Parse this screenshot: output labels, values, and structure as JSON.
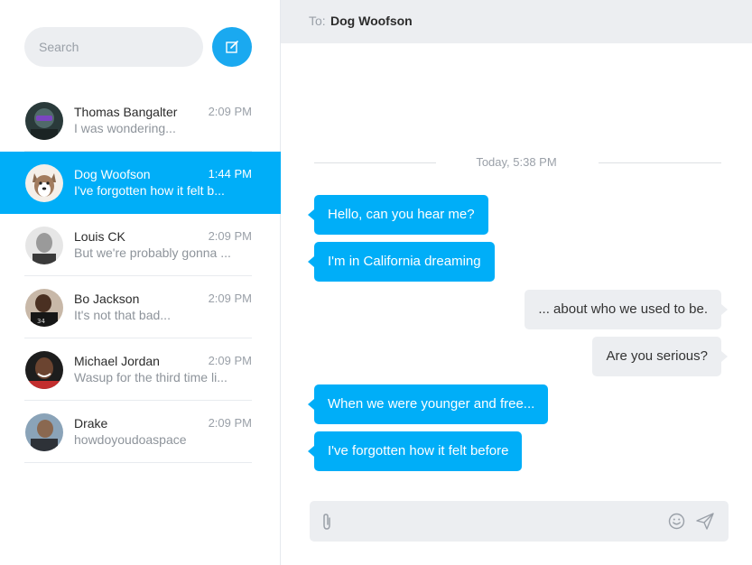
{
  "sidebar": {
    "search": {
      "placeholder": "Search",
      "value": ""
    },
    "compose": {
      "icon": "compose-icon",
      "color": "#1aa9f0"
    },
    "contacts": [
      {
        "name": "Thomas Bangalter",
        "time": "2:09 PM",
        "preview": "I was wondering...",
        "active": false
      },
      {
        "name": "Dog Woofson",
        "time": "1:44 PM",
        "preview": "I've forgotten how it felt b...",
        "active": true
      },
      {
        "name": "Louis CK",
        "time": "2:09 PM",
        "preview": "But we're probably gonna ...",
        "active": false
      },
      {
        "name": "Bo Jackson",
        "time": "2:09 PM",
        "preview": "It's not that bad...",
        "active": false
      },
      {
        "name": "Michael Jordan",
        "time": "2:09 PM",
        "preview": "Wasup for the third time li...",
        "active": false
      },
      {
        "name": "Drake",
        "time": "2:09 PM",
        "preview": "howdoyoudoaspace",
        "active": false
      }
    ]
  },
  "chat": {
    "to_label": "To:",
    "to_name": "Dog Woofson",
    "date_divider": "Today, 5:38 PM",
    "messages": [
      {
        "from": "me",
        "text": "Hello, can you hear me?"
      },
      {
        "from": "me",
        "text": "I'm in California dreaming"
      },
      {
        "from": "them",
        "text": "... about who we used to be."
      },
      {
        "from": "them",
        "text": "Are you serious?"
      },
      {
        "from": "me",
        "text": "When we were younger and free..."
      },
      {
        "from": "me",
        "text": "I've forgotten how it felt before"
      }
    ],
    "composer": {
      "placeholder": "",
      "value": ""
    }
  },
  "colors": {
    "accent": "#00aef8",
    "panel": "#eceef1"
  },
  "icons": [
    "compose-icon",
    "paperclip-icon",
    "emoji-icon",
    "send-icon"
  ]
}
